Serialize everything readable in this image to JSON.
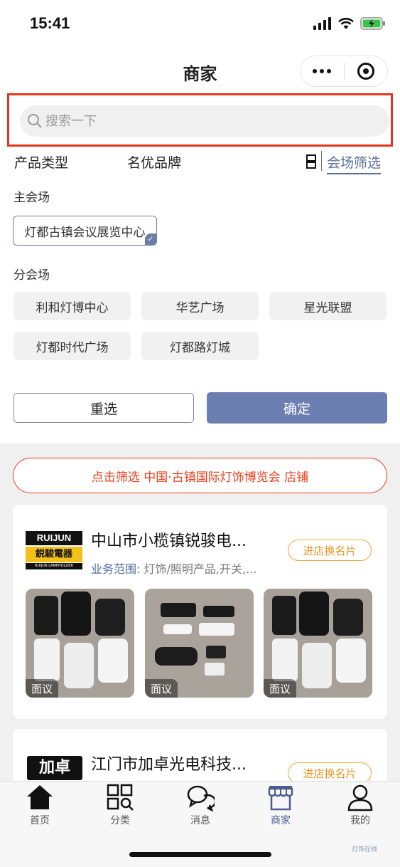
{
  "status": {
    "time": "15:41"
  },
  "nav": {
    "title": "商家"
  },
  "search": {
    "placeholder": "搜索一下"
  },
  "filter_tabs": {
    "product_type": "产品类型",
    "brand": "名优品牌",
    "venue": "会场筛选"
  },
  "main_venue": {
    "label": "主会场",
    "selected": "灯都古镇会议展览中心"
  },
  "sub_venue": {
    "label": "分会场",
    "options": [
      "利和灯博中心",
      "华艺广场",
      "星光联盟",
      "灯都时代广场",
      "灯都路灯城"
    ]
  },
  "actions": {
    "reset": "重选",
    "confirm": "确定"
  },
  "banner": {
    "text": "点击筛选 中国·古镇国际灯饰博览会 店铺"
  },
  "merchants": [
    {
      "logo_text": "RUIJUN",
      "logo_cn": "鋭駿電器",
      "logo_sub": "RUIJUN LAMPHOLDER",
      "name": "中山市小榄镇锐骏电...",
      "scope_key": "业务范围:",
      "scope_value": "灯饰/照明产品,开关,...",
      "button": "进店换名片",
      "photo_tag": "面议"
    },
    {
      "logo_text": "加卓",
      "name": "江门市加卓光电科技...",
      "button": "进店换名片"
    }
  ],
  "tabbar": {
    "items": [
      {
        "label": "首页",
        "icon": "home-icon"
      },
      {
        "label": "分类",
        "icon": "category-icon"
      },
      {
        "label": "消息",
        "icon": "message-icon"
      },
      {
        "label": "商家",
        "icon": "shop-icon"
      },
      {
        "label": "我的",
        "icon": "user-icon"
      }
    ],
    "active_color": "#4a5d8f"
  },
  "watermark": "灯饰在线"
}
